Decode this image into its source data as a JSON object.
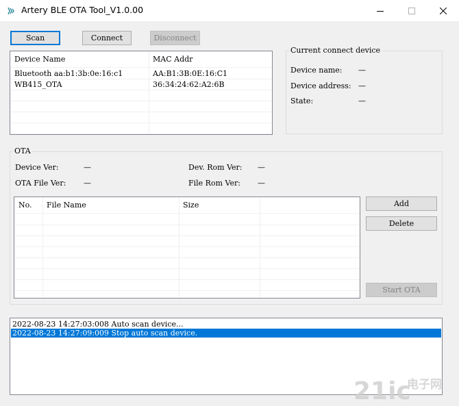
{
  "window": {
    "title": "Artery BLE OTA Tool_V1.0.00"
  },
  "toolbar": {
    "scan_label": "Scan",
    "connect_label": "Connect",
    "disconnect_label": "Disconnect"
  },
  "device_list": {
    "columns": [
      "Device Name",
      "MAC Addr"
    ],
    "rows": [
      {
        "name": "Bluetooth aa:b1:3b:0e:16:c1",
        "mac": "AA:B1:3B:0E:16:C1"
      },
      {
        "name": "WB415_OTA",
        "mac": "36:34:24:62:A2:6B"
      }
    ]
  },
  "current_device": {
    "title": "Current connect device",
    "name_label": "Device name:",
    "name_value": "—",
    "address_label": "Device address:",
    "address_value": "—",
    "state_label": "State:",
    "state_value": "—"
  },
  "ota": {
    "title": "OTA",
    "device_ver_label": "Device Ver:",
    "device_ver_value": "—",
    "dev_rom_ver_label": "Dev. Rom Ver:",
    "dev_rom_ver_value": "—",
    "ota_file_ver_label": "OTA File Ver:",
    "ota_file_ver_value": "—",
    "file_rom_ver_label": "File Rom Ver:",
    "file_rom_ver_value": "—",
    "columns": [
      "No.",
      "File Name",
      "Size"
    ],
    "add_label": "Add",
    "delete_label": "Delete",
    "start_label": "Start OTA"
  },
  "log": {
    "lines": [
      "2022-08-23 14:27:03:008 Auto scan device...",
      "2022-08-23 14:27:09:009 Stop auto scan device."
    ]
  },
  "watermark": {
    "text_main": "21ic",
    "text_cn": "电子网"
  },
  "colors": {
    "accent": "#0078d7",
    "window_bg": "#f0f0f0",
    "list_bg": "#ffffff",
    "border": "#828790"
  }
}
